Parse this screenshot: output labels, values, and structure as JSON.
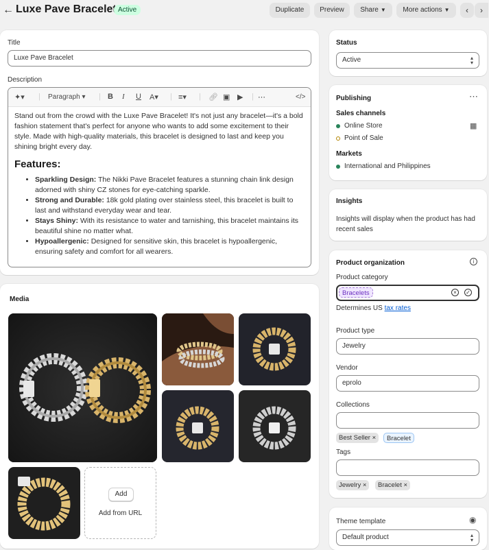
{
  "header": {
    "title": "Luxe Pave Bracelet",
    "status_badge": "Active",
    "duplicate": "Duplicate",
    "preview": "Preview",
    "share": "Share",
    "more_actions": "More actions"
  },
  "main": {
    "title_label": "Title",
    "title_value": "Luxe Pave Bracelet",
    "description_label": "Description",
    "toolbar": {
      "paragraph": "Paragraph"
    },
    "description": {
      "intro": "Stand out from the crowd with the Luxe Pave Bracelet! It's not just any bracelet—it's a bold fashion statement that's perfect for anyone who wants to add some excitement to their style. Made with high-quality materials, this bracelet is designed to last and keep you shining bright every day.",
      "heading": "Features:",
      "features": [
        {
          "title": "Sparkling Design:",
          "text": " The Nikki Pave Bracelet features a stunning chain link design adorned with shiny CZ stones for eye-catching sparkle."
        },
        {
          "title": "Strong and Durable:",
          "text": " 18k gold plating over stainless steel, this bracelet is built to last and withstand everyday wear and tear."
        },
        {
          "title": "Stays Shiny:",
          "text": " With its resistance to water and tarnishing, this bracelet maintains its beautiful shine no matter what."
        },
        {
          "title": "Hypoallergenic:",
          "text": " Designed for sensitive skin, this bracelet is hypoallergenic, ensuring safety and comfort for all wearers."
        }
      ]
    },
    "media_label": "Media",
    "media_add": "Add",
    "media_add_url": "Add from URL"
  },
  "sidebar": {
    "status_label": "Status",
    "status_value": "Active",
    "publishing_label": "Publishing",
    "sales_channels_label": "Sales channels",
    "channels": [
      "Online Store",
      "Point of Sale"
    ],
    "markets_label": "Markets",
    "market": "International and Philippines",
    "insights_label": "Insights",
    "insights_text": "Insights will display when the product has had recent sales",
    "org_label": "Product organization",
    "category_label": "Product category",
    "category_value": "Bracelets",
    "determines": "Determines US",
    "tax_rates": "tax rates",
    "type_label": "Product type",
    "type_value": "Jewelry",
    "vendor_label": "Vendor",
    "vendor_value": "eprolo",
    "collections_label": "Collections",
    "collections": [
      "Best Seller",
      "Bracelet"
    ],
    "tags_label": "Tags",
    "tags": [
      "Jewelry",
      "Bracelet"
    ],
    "theme_label": "Theme template",
    "theme_value": "Default product"
  },
  "colors": {
    "active_badge_bg": "#cdfee1",
    "online_dot": "#29845a",
    "pos_dot": "#b28400",
    "link": "#005bd3"
  }
}
